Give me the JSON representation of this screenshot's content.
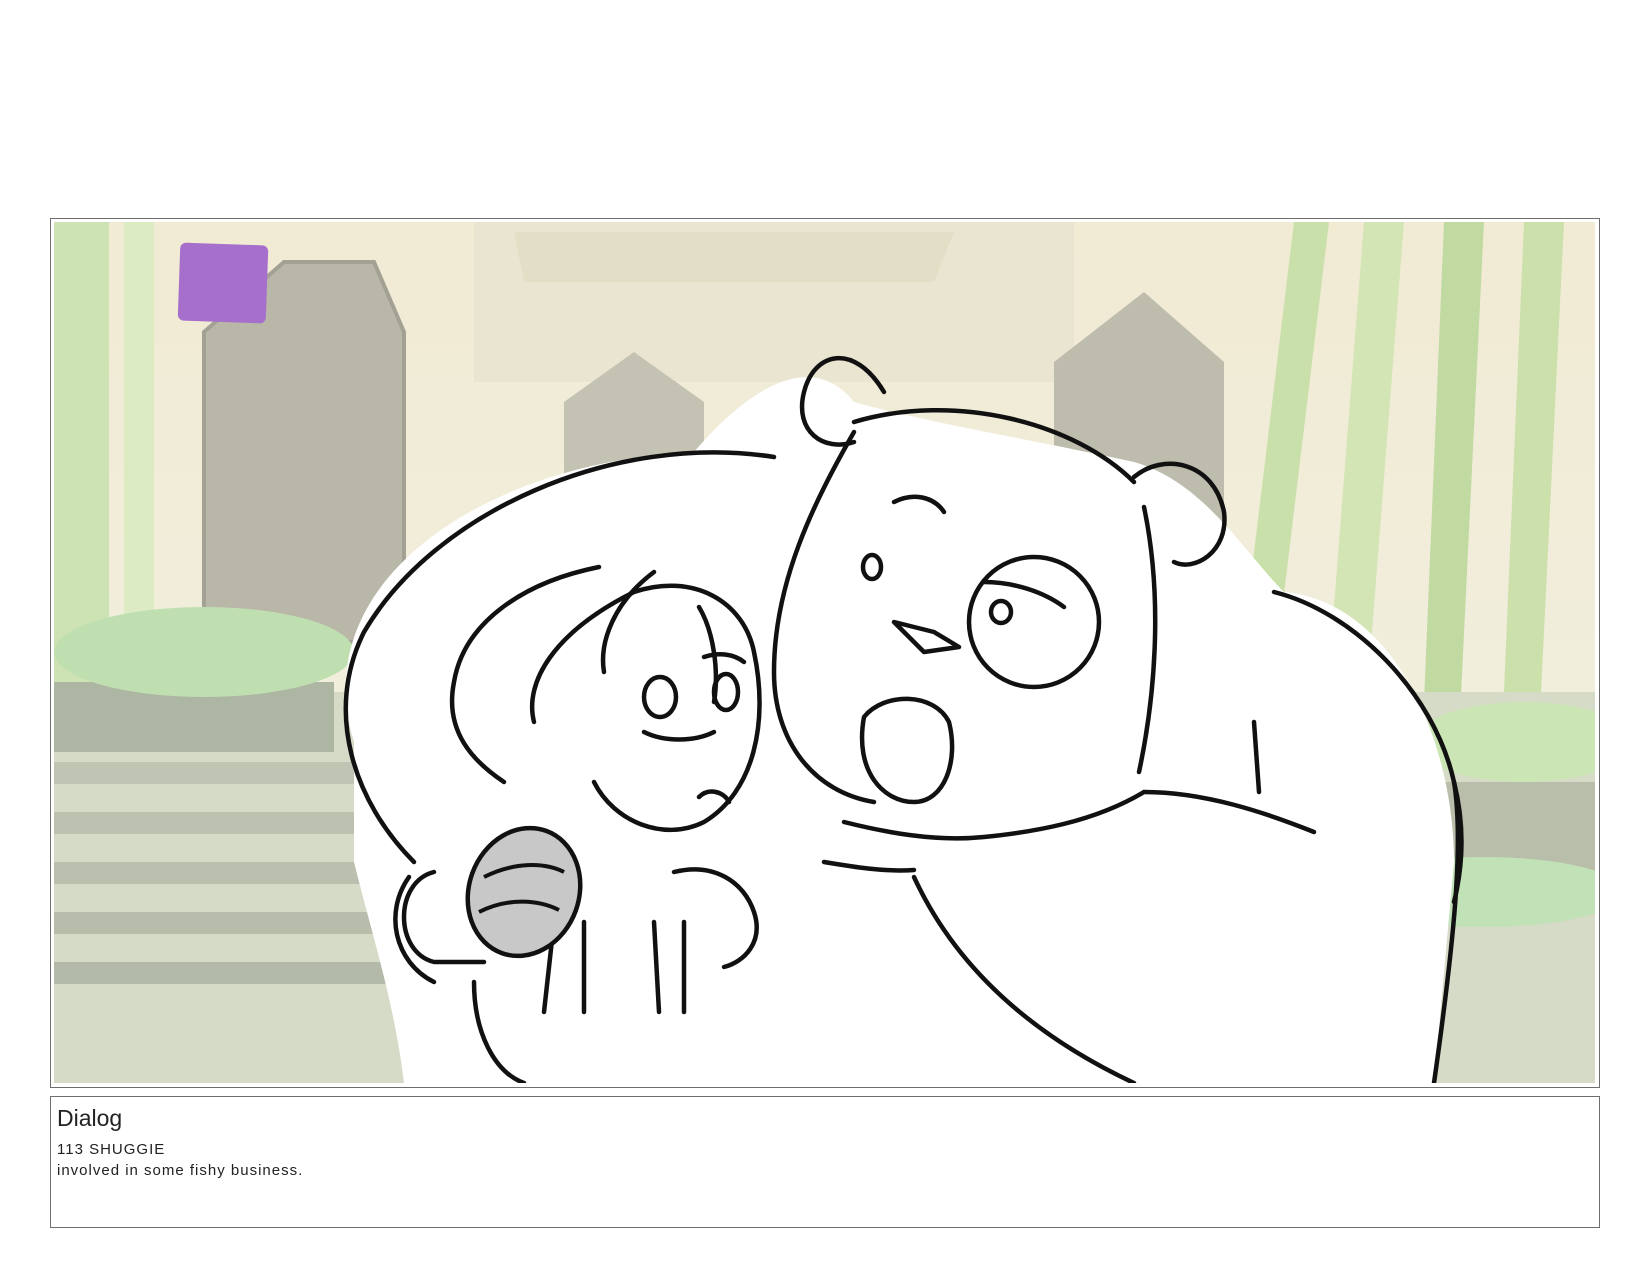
{
  "panel": {
    "background_description_colors": {
      "sky": "#efe9c8",
      "bamboo": "#b9d98c",
      "stone": "#b8b79a",
      "doorway": "#8f8e7a",
      "foliage": "#9ccc8a"
    },
    "marker_color": "#a56fcb",
    "prop_color": "#c8c8c8"
  },
  "dialog": {
    "heading": "Dialog",
    "line1": "113 SHUGGIE",
    "line2": "involved in some fishy business."
  }
}
